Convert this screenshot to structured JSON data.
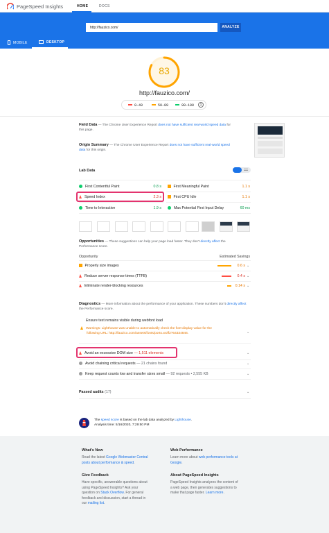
{
  "header": {
    "brand": "PageSpeed Insights",
    "tabs": [
      "HOME",
      "DOCS"
    ]
  },
  "search": {
    "url_value": "http://fauzico.com/",
    "analyze_label": "ANALYZE"
  },
  "device_tabs": [
    "MOBILE",
    "DESKTOP"
  ],
  "score": {
    "value": "83",
    "fraction": 0.83,
    "site": "http://fauzico.com/",
    "legend": [
      "0–49",
      "50–89",
      "90–100"
    ]
  },
  "field_data": {
    "title": "Field Data",
    "text_pre": "— The Chrome User Experience Report ",
    "link": "does not have sufficient real-world speed data",
    "text_post": " for this page."
  },
  "origin_summary": {
    "title": "Origin Summary",
    "text_pre": "— The Chrome User Experience Report ",
    "link": "does not have sufficient real-world speed data",
    "text_post": " for this origin."
  },
  "lab_data": {
    "title": "Lab Data",
    "metrics": [
      {
        "label": "First Contentful Paint",
        "value": "0.8 s",
        "status": "good"
      },
      {
        "label": "First Meaningful Paint",
        "value": "1.1 s",
        "status": "average"
      },
      {
        "label": "Speed Index",
        "value": "2.3 s",
        "status": "poor"
      },
      {
        "label": "First CPU Idle",
        "value": "1.1 s",
        "status": "average"
      },
      {
        "label": "Time to Interactive",
        "value": "1.9 s",
        "status": "good"
      },
      {
        "label": "Max Potential First Input Delay",
        "value": "60 ms",
        "status": "good"
      }
    ]
  },
  "opportunities": {
    "title": "Opportunities",
    "desc_pre": "— These suggestions can help your page load faster. They don't ",
    "desc_link": "directly affect",
    "desc_post": " the Performance score.",
    "col_left": "Opportunity",
    "col_right": "Estimated Savings",
    "items": [
      {
        "label": "Properly size images",
        "value": "0.6 s",
        "status": "average",
        "bar_fraction": 0.85
      },
      {
        "label": "Reduce server response times (TTFB)",
        "value": "0.4 s",
        "status": "poor",
        "bar_fraction": 0.6
      },
      {
        "label": "Eliminate render-blocking resources",
        "value": "0.14 s",
        "status": "average",
        "bar_fraction": 0.25
      }
    ]
  },
  "diagnostics": {
    "title": "Diagnostics",
    "desc_pre": "— More information about the performance of your application. These numbers don't ",
    "desc_link": "directly affect",
    "desc_post": " the Performance score.",
    "font_title": "Ensure text remains visible during webfont load",
    "warning_line1": "Warnings: Lighthouse was unable to automatically check the font-display value for the",
    "warning_line2": "following URL: http://fauzico.com/assets/fonts/porto.woff2?64334846.",
    "items": [
      {
        "label": "Avoid an excessive DOM size",
        "detail": "— 1,511 elements",
        "status": "poor"
      },
      {
        "label": "Avoid chaining critical requests",
        "detail": "— 21 chains found",
        "status": "neutral"
      },
      {
        "label": "Keep request counts low and transfer sizes small",
        "detail": "— 92 requests • 2,555 KB",
        "status": "neutral"
      }
    ]
  },
  "passed": {
    "label": "Passed audits",
    "count": "(17)"
  },
  "analysis": {
    "line1_pre": "The ",
    "line1_link": "speed score",
    "line1_mid": " is based on the lab data analyzed by ",
    "line1_link2": "Lighthouse",
    "line1_post": ".",
    "line2": "Analysis time: 5/16/2020, 7:29:50 PM"
  },
  "footer": {
    "whats_new": {
      "title": "What's New",
      "l1_pre": "Read the latest ",
      "l1_link": "Google Webmaster Central",
      "l2_link": "posts about performance & speed",
      "l2_post": "."
    },
    "web_perf": {
      "title": "Web Performance",
      "l1_pre": "Learn more about ",
      "l1_link": "web performance tools at",
      "l2_link": "Google",
      "l2_post": "."
    },
    "feedback": {
      "title": "Give Feedback",
      "lines": [
        "Have specific, answerable questions about",
        "using PageSpeed Insights? Ask your",
        "question on ",
        "feedback and discussion, start a thread in",
        "our "
      ],
      "so_link": "Stack Overflow",
      "so_post": ". For general",
      "ml_link": "mailing list",
      "ml_post": "."
    },
    "about": {
      "title": "About PageSpeed Insights",
      "lines": [
        "PageSpeed Insights analyzes the content of",
        "a web page, then generates suggestions to",
        "make that page faster. "
      ],
      "link": "Learn more",
      "post": "."
    }
  },
  "colors": {
    "primary": "#1a73e8",
    "good": "#0cce6b",
    "average": "#ffa400",
    "poor": "#ff4e42",
    "highlight": "#e3336e"
  }
}
